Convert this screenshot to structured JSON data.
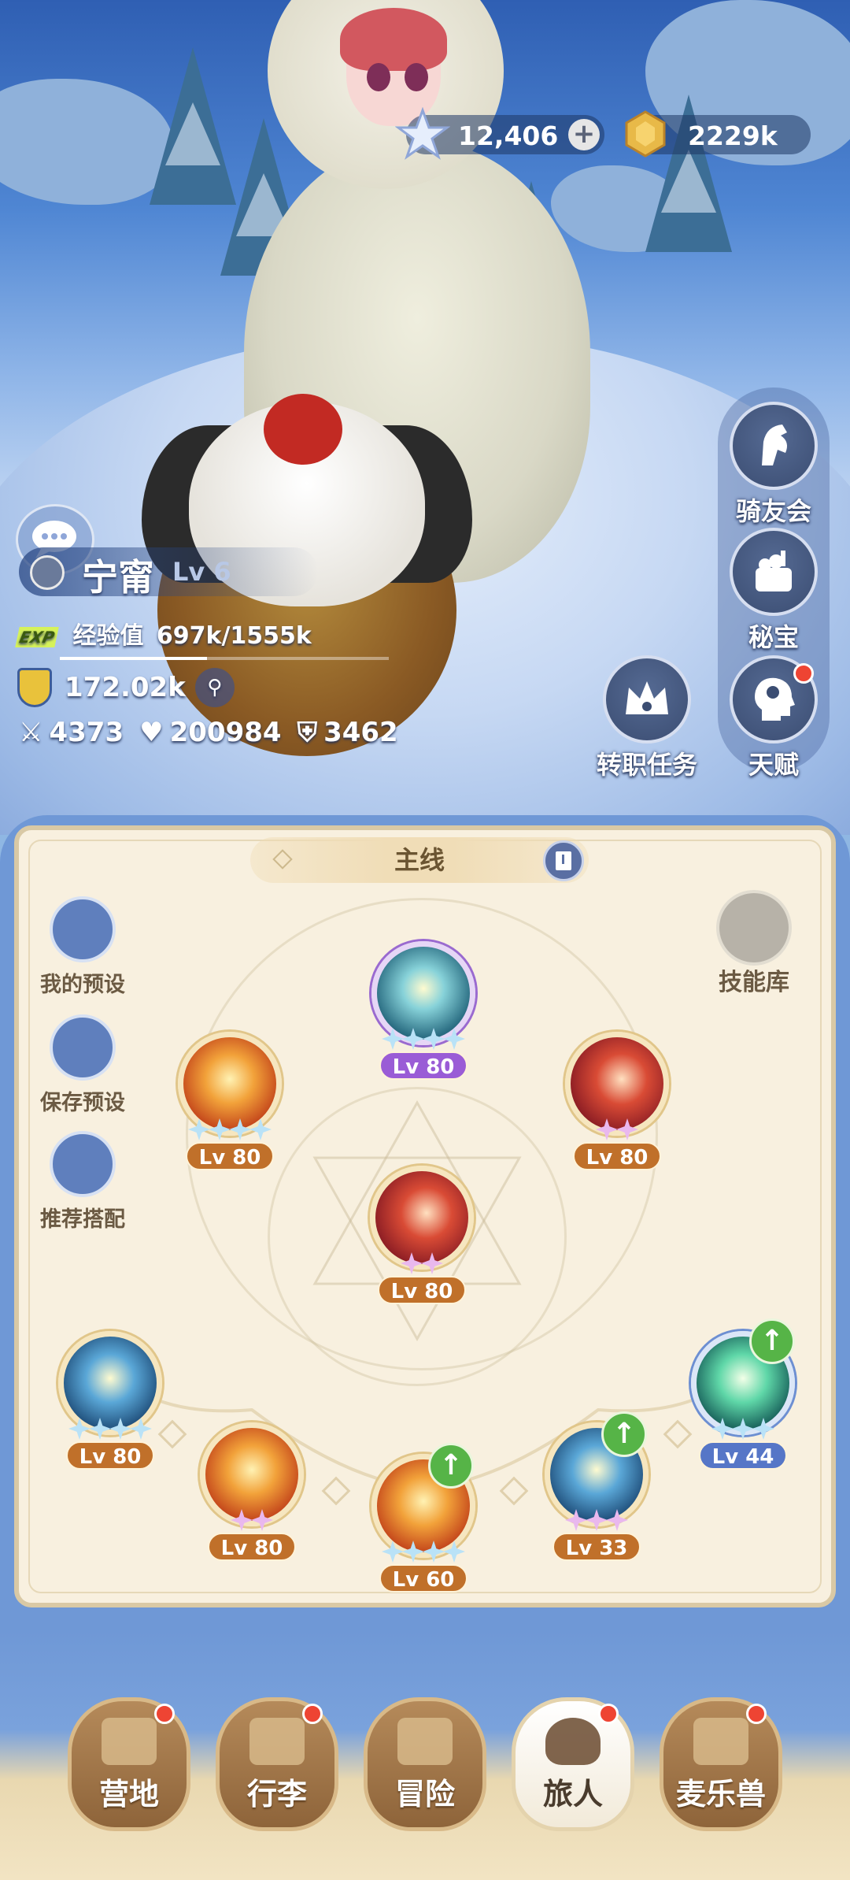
{
  "currency": {
    "gems": "12,406",
    "gold": "2229k",
    "gem_icon": "crystal-star-icon",
    "gold_icon": "hexagon-coin-icon"
  },
  "side_menu": {
    "items": [
      {
        "label": "骑友会",
        "icon": "horse-head-icon"
      },
      {
        "label": "秘宝",
        "icon": "treasure-box-icon"
      },
      {
        "label": "天赋",
        "icon": "brain-head-icon"
      }
    ],
    "job_quest": {
      "label": "转职任务",
      "icon": "crown-emblem-icon"
    }
  },
  "player": {
    "name": "宁甯",
    "level": "Lv 6",
    "exp_badge": "EXP",
    "exp_label": "经验值",
    "exp_value": "697k/1555k",
    "exp_progress": 0.448,
    "power": "172.02k",
    "attack": "4373",
    "hp": "200984",
    "defense": "3462"
  },
  "panel": {
    "tab_label": "主线",
    "presets": [
      {
        "label": "我的预设",
        "icon": "card-icon"
      },
      {
        "label": "保存预设",
        "icon": "floppy-disk-icon"
      },
      {
        "label": "推荐搭配",
        "icon": "swirl-icon"
      }
    ],
    "skill_library": "技能库",
    "skills": [
      {
        "id": "top",
        "level": "Lv 80",
        "color": "purple"
      },
      {
        "id": "left",
        "level": "Lv 80",
        "color": "orange"
      },
      {
        "id": "right",
        "level": "Lv 80",
        "color": "orange"
      },
      {
        "id": "center",
        "level": "Lv 80",
        "color": "orange"
      },
      {
        "id": "bottom-1",
        "level": "Lv 80",
        "color": "orange"
      },
      {
        "id": "bottom-2",
        "level": "Lv 80",
        "color": "orange"
      },
      {
        "id": "bottom-3",
        "level": "Lv 60",
        "color": "orange",
        "upgradable": true
      },
      {
        "id": "bottom-4",
        "level": "Lv 33",
        "color": "orange",
        "upgradable": true
      },
      {
        "id": "bottom-5",
        "level": "Lv 44",
        "color": "blue",
        "upgradable": true
      }
    ]
  },
  "nav": {
    "items": [
      {
        "label": "营地",
        "icon": "castle-icon",
        "badge": true
      },
      {
        "label": "行李",
        "icon": "chest-icon",
        "badge": true
      },
      {
        "label": "冒险",
        "icon": "crossed-swords-icon",
        "badge": false
      },
      {
        "label": "旅人",
        "icon": "traveler-portrait-icon",
        "badge": true,
        "active": true
      },
      {
        "label": "麦乐兽",
        "icon": "fox-pet-icon",
        "badge": true
      }
    ]
  }
}
